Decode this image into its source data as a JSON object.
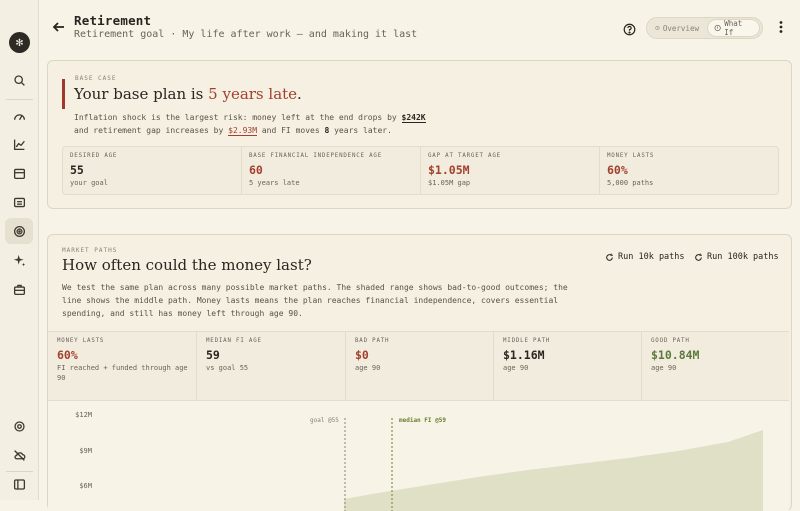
{
  "header": {
    "title": "Retirement",
    "subtitle": "Retirement goal · My life after work — and making it last",
    "views": [
      {
        "label": "Overview",
        "active": true
      },
      {
        "label": "What If",
        "active": false
      }
    ]
  },
  "base_case": {
    "eyebrow": "BASE CASE",
    "headline_prefix": "Your base plan is ",
    "headline_late": "5 years late",
    "headline_suffix": ".",
    "line1_a": "Inflation shock is the largest risk: money left at the end drops by ",
    "line1_amount": "$242K",
    "line2_a": "and retirement gap increases by ",
    "line2_amount": "$2.93M",
    "line2_b": " and FI moves ",
    "line2_years": "8",
    "line2_c": " years later.",
    "stats": [
      {
        "label": "DESIRED AGE",
        "value": "55",
        "sub": "your goal",
        "tone": "normal"
      },
      {
        "label": "BASE FINANCIAL INDEPENDENCE AGE",
        "value": "60",
        "sub": "5 years late",
        "tone": "red"
      },
      {
        "label": "GAP AT TARGET AGE",
        "value": "$1.05M",
        "sub": "$1.05M gap",
        "tone": "red"
      },
      {
        "label": "MONEY LASTS",
        "value": "60%",
        "sub": "5,000 paths",
        "tone": "red"
      }
    ]
  },
  "market_paths": {
    "eyebrow": "MARKET PATHS",
    "headline": "How often could the money last?",
    "run_10k": "Run 10k paths",
    "run_100k": "Run 100k paths",
    "description": [
      "We test the same plan across many possible market paths. The shaded range shows bad-to-good outcomes; the",
      "line shows the middle path. Money lasts means the plan reaches financial independence, covers essential",
      "spending, and still has money left through age 90."
    ],
    "stats": [
      {
        "label": "MONEY LASTS",
        "value": "60%",
        "sub": "FI reached + funded through age 90",
        "tone": "red"
      },
      {
        "label": "MEDIAN FI AGE",
        "value": "59",
        "sub": "vs goal 55",
        "tone": "normal"
      },
      {
        "label": "BAD PATH",
        "value": "$0",
        "sub": "age 90",
        "tone": "red"
      },
      {
        "label": "MIDDLE PATH",
        "value": "$1.16M",
        "sub": "age 90",
        "tone": "normal"
      },
      {
        "label": "GOOD PATH",
        "value": "$10.84M",
        "sub": "age 90",
        "tone": "green"
      }
    ]
  },
  "chart_data": {
    "type": "area",
    "y_ticks": [
      "$12M",
      "$9M",
      "$6M"
    ],
    "annotations": [
      {
        "label": "goal @55",
        "age": 55
      },
      {
        "label": "median FI @59",
        "age": 59
      }
    ],
    "colors": {
      "band": "#dfe0c6",
      "goal": "#8a8274",
      "median": "#6d7f2e"
    }
  },
  "colors": {
    "accent_red": "#a3402e",
    "accent_green": "#5d7a3e",
    "background": "#f7f3e6"
  }
}
